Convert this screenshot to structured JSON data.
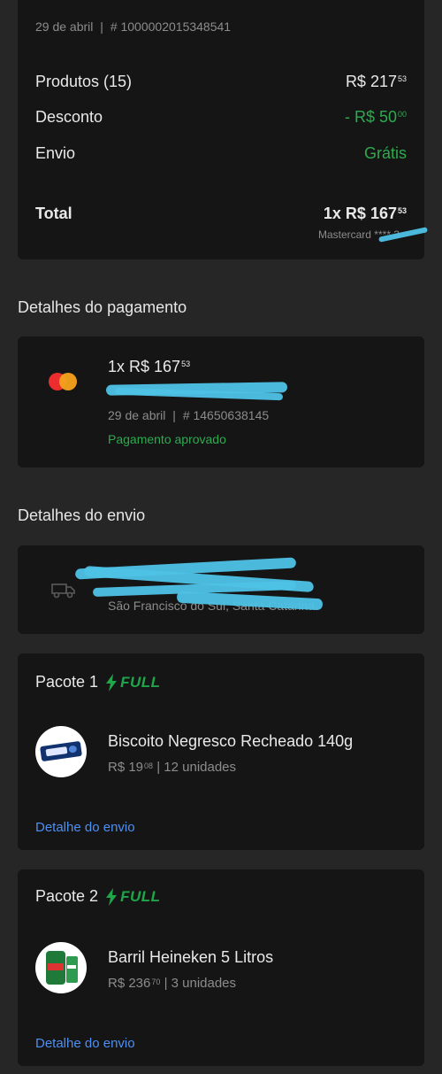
{
  "order": {
    "date": "29 de abril",
    "number": "# 1000002015348541",
    "rows": [
      {
        "label": "Produtos (15)",
        "value": "R$ 217",
        "cents": "53"
      },
      {
        "label": "Desconto",
        "value": "- R$ 50",
        "cents": "00"
      },
      {
        "label": "Envio",
        "value": "Grátis",
        "cents": ""
      }
    ],
    "total_label": "Total",
    "total_value": "1x R$ 167",
    "total_cents": "53",
    "card_info": "Mastercard **** 3"
  },
  "payment": {
    "section_title": "Detalhes do pagamento",
    "amount": "1x R$ 167",
    "cents": "53",
    "date": "29 de abril",
    "number": "# 14650638145",
    "status": "Pagamento aprovado"
  },
  "shipping": {
    "section_title": "Detalhes do envio",
    "address": "São Francisco do Sul, Santa Catarina."
  },
  "packages": [
    {
      "title": "Pacote 1",
      "badge": "FULL",
      "product": "Biscoito Negresco Recheado 140g",
      "price": "R$ 19",
      "cents": "08",
      "quantity": "| 12 unidades",
      "link": "Detalhe do envio"
    },
    {
      "title": "Pacote 2",
      "badge": "FULL",
      "product": "Barril Heineken 5 Litros",
      "price": "R$ 236",
      "cents": "70",
      "quantity": "| 3 unidades",
      "link": "Detalhe do envio"
    }
  ],
  "colors": {
    "background": "#262626",
    "card": "#151515",
    "green": "#2dab4f",
    "link": "#4d8ff2"
  }
}
